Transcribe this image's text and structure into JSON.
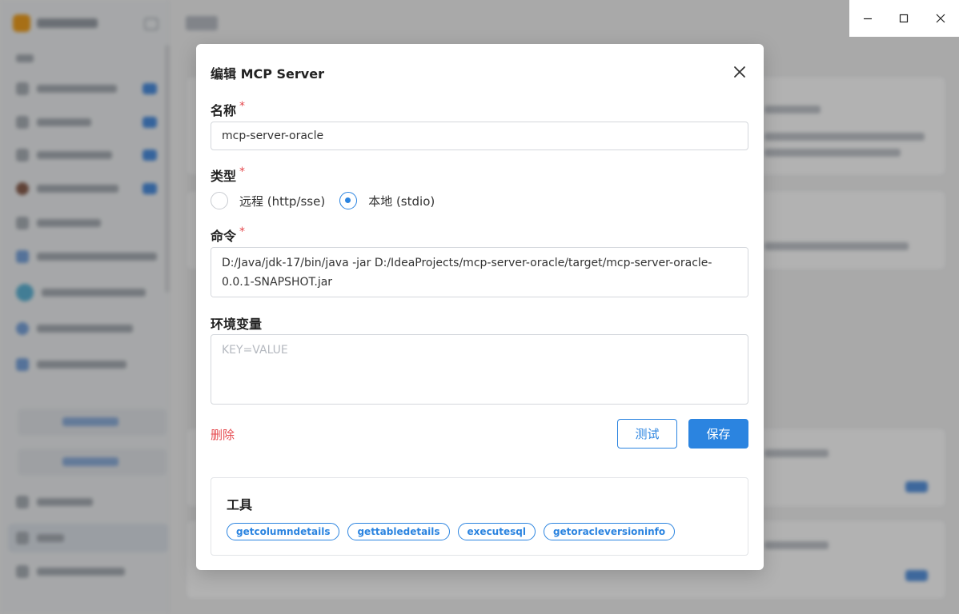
{
  "window_controls": {
    "minimize_icon": "minimize-icon",
    "maximize_icon": "maximize-icon",
    "close_icon": "close-icon"
  },
  "dialog": {
    "title": "编辑 MCP Server",
    "close_icon": "close-icon",
    "name": {
      "label": "名称",
      "required": "*",
      "value": "mcp-server-oracle"
    },
    "type": {
      "label": "类型",
      "required": "*",
      "options": [
        {
          "label": "远程 (http/sse)",
          "selected": false
        },
        {
          "label": "本地 (stdio)",
          "selected": true
        }
      ]
    },
    "command": {
      "label": "命令",
      "required": "*",
      "value": "D:/Java/jdk-17/bin/java -jar D:/IdeaProjects/mcp-server-oracle/target/mcp-server-oracle-0.0.1-SNAPSHOT.jar"
    },
    "env": {
      "label": "环境变量",
      "placeholder": "KEY=VALUE",
      "value": ""
    },
    "delete_label": "删除",
    "test_label": "测试",
    "save_label": "保存",
    "tools": {
      "title": "工具",
      "items": [
        "getcolumndetails",
        "gettabledetails",
        "executesql",
        "getoracleversioninfo"
      ]
    }
  },
  "colors": {
    "accent": "#2b84e0",
    "danger": "#e5484d"
  }
}
